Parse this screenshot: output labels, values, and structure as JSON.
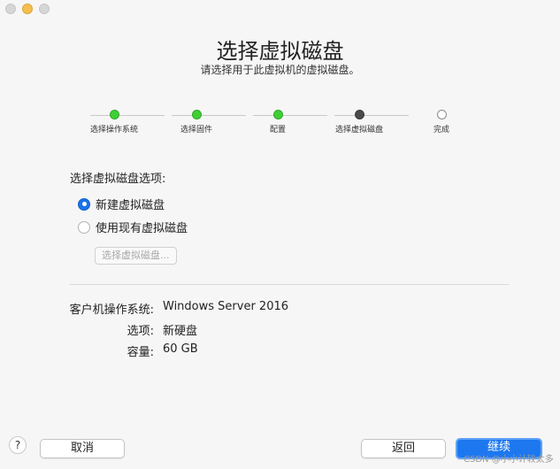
{
  "window": {
    "title": "选择虚拟磁盘",
    "subtitle": "请选择用于此虚拟机的虚拟磁盘。"
  },
  "steps": [
    {
      "label": "选择操作系统",
      "state": "done"
    },
    {
      "label": "选择固件",
      "state": "done"
    },
    {
      "label": "配置",
      "state": "done"
    },
    {
      "label": "选择虚拟磁盘",
      "state": "current"
    },
    {
      "label": "完成",
      "state": "todo"
    }
  ],
  "options": {
    "heading": "选择虚拟磁盘选项:",
    "new_disk": "新建虚拟磁盘",
    "existing_disk": "使用现有虚拟磁盘",
    "selected": "new_disk",
    "choose_button": "选择虚拟磁盘..."
  },
  "summary": {
    "os_key": "客户机操作系统:",
    "os_value": "Windows Server 2016",
    "option_key": "选项:",
    "option_value": "新硬盘",
    "capacity_key": "容量:",
    "capacity_value": "60 GB"
  },
  "footer": {
    "help": "?",
    "cancel": "取消",
    "back": "返回",
    "continue": "继续"
  },
  "watermark": "CSDN @小小计较太多",
  "colors": {
    "accent": "#1d78f0",
    "step_done": "#3fcf35",
    "step_current": "#4a4a4a"
  }
}
